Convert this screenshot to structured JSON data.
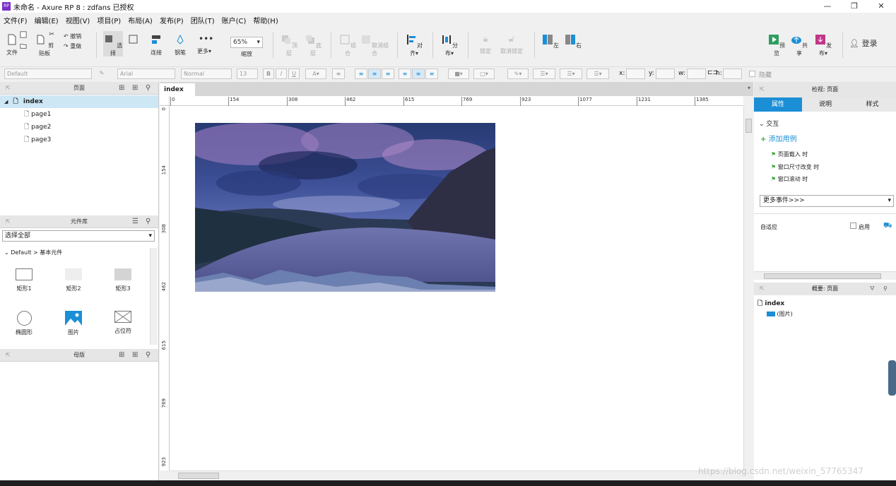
{
  "window": {
    "title": "未命名 - Axure RP 8 : zdfans 已授权",
    "logo": "RP",
    "min": "—",
    "max": "❐",
    "close": "✕"
  },
  "menu": [
    "文件(F)",
    "编辑(E)",
    "视图(V)",
    "项目(P)",
    "布局(A)",
    "发布(P)",
    "团队(T)",
    "账户(C)",
    "帮助(H)"
  ],
  "toolbar": {
    "file": "文件",
    "clipboard": "剪贴板",
    "undo": "撤销",
    "redo": "重做",
    "select": "选择",
    "connect": "连接",
    "pen": "钢笔",
    "more": "更多▾",
    "zoom_value": "65%",
    "zoom_label": "缩放",
    "top": "顶层",
    "bottom": "底层",
    "group": "组合",
    "ungroup": "取消组合",
    "align": "对齐▾",
    "distribute": "分布▾",
    "lock": "锁定",
    "unlock": "取消锁定",
    "left": "左",
    "right": "右",
    "preview": "预览",
    "share": "共享",
    "publish": "发布▾",
    "login": "登录"
  },
  "format": {
    "style": "Default",
    "font": "Arial",
    "weight": "Normal",
    "size": "13",
    "x": "x:",
    "y": "y:",
    "w": "w:",
    "h": "h:",
    "hide": "隐藏"
  },
  "pages_panel": {
    "title": "页面",
    "root": "index",
    "items": [
      "page1",
      "page2",
      "page3"
    ]
  },
  "widgets_panel": {
    "title": "元件库",
    "filter": "选择全部",
    "group": "Default > 基本元件",
    "items": [
      "矩形1",
      "矩形2",
      "矩形3",
      "椭圆形",
      "图片",
      "占位符"
    ]
  },
  "masters_panel": {
    "title": "母版"
  },
  "doc_tab": {
    "label": "index",
    "close": "×"
  },
  "ruler": {
    "h": [
      "0",
      "154",
      "308",
      "462",
      "615",
      "769",
      "923",
      "1077",
      "1231",
      "1385"
    ],
    "v": [
      "0",
      "154",
      "308",
      "462",
      "615",
      "769",
      "923"
    ]
  },
  "inspector": {
    "title": "检视: 页面",
    "tabs": [
      "属性",
      "说明",
      "样式"
    ],
    "section": "交互",
    "add_case": "添加用例",
    "events": [
      "页面载入 时",
      "窗口尺寸改变 时",
      "窗口滚动 时"
    ],
    "more_events": "更多事件>>>",
    "adaptive": "自适应",
    "enable": "启用"
  },
  "outline": {
    "title": "概要: 页面",
    "root": "index",
    "item": "(图片)"
  },
  "watermark": "https://blog.csdn.net/weixin_57765347",
  "colors": {
    "accent": "#1b8fd6",
    "tab_active": "#1b8fd6",
    "green": "#3aa83a"
  }
}
